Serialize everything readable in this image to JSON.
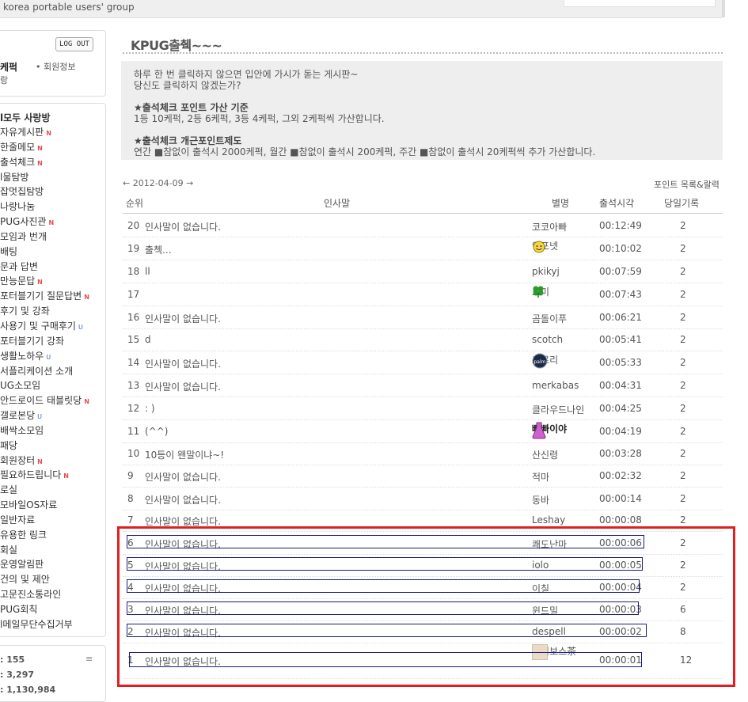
{
  "site_name": "korea portable users' group",
  "login": {
    "logout_label": "LOG OUT",
    "user_name": "케퍽",
    "member_info": "• 회원정보",
    "user_line2": "랑"
  },
  "menu": {
    "title": "l모두 사랑방",
    "items": [
      {
        "label": "자유게시판",
        "mark": "N"
      },
      {
        "label": "한줄메모",
        "mark": "N"
      },
      {
        "label": "출석체크",
        "mark": "N"
      },
      {
        "label": "l물탐방",
        "mark": ""
      },
      {
        "label": "잡멋집탐방",
        "mark": ""
      },
      {
        "label": "나랑나눔",
        "mark": ""
      },
      {
        "label": "PUG사진관",
        "mark": "N"
      },
      {
        "label": "모임과 번개",
        "mark": ""
      },
      {
        "label": "배팅",
        "mark": ""
      },
      {
        "label": "문과 답변",
        "mark": ""
      },
      {
        "label": "만능문답",
        "mark": "N"
      },
      {
        "label": "포터블기기 질문답변",
        "mark": "N"
      },
      {
        "label": "후기 및 강좌",
        "mark": ""
      },
      {
        "label": "사용기 및 구매후기",
        "mark": "U"
      },
      {
        "label": "포터블기기 강좌",
        "mark": ""
      },
      {
        "label": "생활노하우",
        "mark": "U"
      },
      {
        "label": "서플리케이션 소개",
        "mark": ""
      },
      {
        "label": "UG소모임",
        "mark": ""
      },
      {
        "label": "안드로이드 태블릿당",
        "mark": "N"
      },
      {
        "label": "갤로본당",
        "mark": "U"
      },
      {
        "label": "배싹소모임",
        "mark": ""
      },
      {
        "label": "패당",
        "mark": ""
      },
      {
        "label": "회원장터",
        "mark": "N"
      },
      {
        "label": "필요하드립니다",
        "mark": "N"
      },
      {
        "label": "로실",
        "mark": ""
      },
      {
        "label": "모바일OS자료",
        "mark": ""
      },
      {
        "label": "일반자료",
        "mark": ""
      },
      {
        "label": "유용한 링크",
        "mark": ""
      },
      {
        "label": "회실",
        "mark": ""
      },
      {
        "label": "운영알림판",
        "mark": ""
      },
      {
        "label": "건의 및 제안",
        "mark": ""
      },
      {
        "label": "고문진소통라인",
        "mark": ""
      },
      {
        "label": "PUG회칙",
        "mark": ""
      },
      {
        "label": "l메일무단수집거부",
        "mark": ""
      }
    ]
  },
  "stats": [
    ": 155",
    ": 3,297",
    ": 1,130,984"
  ],
  "page_title": "KPUG출췍~~~",
  "notice": {
    "line1": "하루 한 번 클릭하지 않으면 입안에 가시가 돋는 게시판~",
    "line2": "당신도 클릭하지 않겠는가?",
    "section1_title": "★출석체크 포인트 가산 기준",
    "section1_body": "1등 10케퍽, 2등 6케퍽, 3등 4케퍽, 그외 2케퍽씩 가산합니다.",
    "section2_title": "★출석체크 개근포인트제도",
    "section2_body": "연간 ■참없이 출석시 2000케퍽, 월간 ■참없이 출석시 200케퍽, 주간 ■참없이 출석시 20케퍽씩 추가 가산합니다."
  },
  "date_nav": "← 2012-04-09 →",
  "point_link": "포인트 목록&랄력",
  "columns": {
    "rank": "순위",
    "greeting": "인사말",
    "nickname": "별명",
    "time": "출석시각",
    "record": "당일기록"
  },
  "rows": [
    {
      "no": "20",
      "msg": "인사말이 없습니다.",
      "nick": "코코아빠",
      "time": "00:12:49",
      "rec": "2",
      "icon": ""
    },
    {
      "no": "19",
      "msg": "출첵...",
      "nick": "인포넷",
      "time": "00:10:02",
      "rec": "2",
      "icon": "smiley-icon"
    },
    {
      "no": "18",
      "msg": "ll",
      "nick": "pkikyj",
      "time": "00:07:59",
      "rec": "2",
      "icon": ""
    },
    {
      "no": "17",
      "msg": "",
      "nick": "로미",
      "time": "00:07:43",
      "rec": "2",
      "icon": "clover-icon"
    },
    {
      "no": "16",
      "msg": "인사말이 없습니다.",
      "nick": "곰돌이푸",
      "time": "00:06:21",
      "rec": "2",
      "icon": ""
    },
    {
      "no": "15",
      "msg": "d",
      "nick": "scotch",
      "time": "00:05:41",
      "rec": "2",
      "icon": ""
    },
    {
      "no": "14",
      "msg": "인사말이 없습니다.",
      "nick": "포로리",
      "time": "00:05:33",
      "rec": "2",
      "icon": "palm-icon"
    },
    {
      "no": "13",
      "msg": "인사말이 없습니다.",
      "nick": "merkabas",
      "time": "00:04:31",
      "rec": "2",
      "icon": ""
    },
    {
      "no": "12",
      "msg": ": )",
      "nick": "클라우드나인",
      "time": "00:04:25",
      "rec": "2",
      "icon": ""
    },
    {
      "no": "11",
      "msg": "(^^)",
      "nick": "빠빠이야",
      "time": "00:04:19",
      "rec": "2",
      "icon": "flask-icon"
    },
    {
      "no": "10",
      "msg": "10등이 왠말이냐~!",
      "nick": "산신령",
      "time": "00:03:28",
      "rec": "2",
      "icon": ""
    },
    {
      "no": "9",
      "msg": "인사말이 없습니다.",
      "nick": "적마",
      "time": "00:02:32",
      "rec": "2",
      "icon": ""
    },
    {
      "no": "8",
      "msg": "인사말이 없습니다.",
      "nick": "동바",
      "time": "00:00:14",
      "rec": "2",
      "icon": ""
    },
    {
      "no": "7",
      "msg": "인사말이 없습니다.",
      "nick": "Leshay",
      "time": "00:00:08",
      "rec": "2",
      "icon": ""
    },
    {
      "no": "6",
      "msg": "인사말이 없습니다.",
      "nick": "쾌도난마",
      "time": "00:00:06",
      "rec": "2",
      "icon": ""
    },
    {
      "no": "5",
      "msg": "인사말이 없습니다.",
      "nick": "iolo",
      "time": "00:00:05",
      "rec": "2",
      "icon": ""
    },
    {
      "no": "4",
      "msg": "인사말이 없습니다.",
      "nick": "이칠",
      "time": "00:00:04",
      "rec": "2",
      "icon": ""
    },
    {
      "no": "3",
      "msg": "인사말이 없습니다.",
      "nick": "윈드밀",
      "time": "00:00:03",
      "rec": "6",
      "icon": ""
    },
    {
      "no": "2",
      "msg": "인사말이 없습니다.",
      "nick": "despell",
      "time": "00:00:02",
      "rec": "8",
      "icon": ""
    },
    {
      "no": "1",
      "msg": "인사말이 없습니다.",
      "nick": "루이보스茶",
      "time": "00:00:01",
      "rec": "12",
      "icon": "avatar-icon"
    }
  ],
  "colors": {
    "highlight_frame": "#e02020",
    "box_outline": "#1a1a80",
    "notice_bg": "#eeeeee"
  }
}
